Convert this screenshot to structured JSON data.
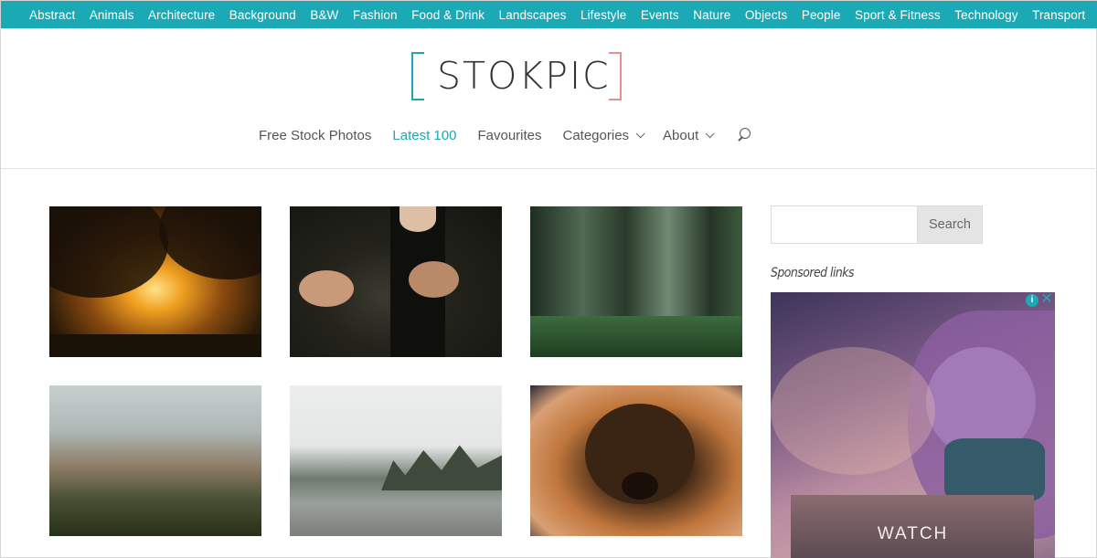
{
  "top_categories": [
    "Abstract",
    "Animals",
    "Architecture",
    "Background",
    "B&W",
    "Fashion",
    "Food & Drink",
    "Landscapes",
    "Lifestyle",
    "Events",
    "Nature",
    "Objects",
    "People",
    "Sport & Fitness",
    "Technology",
    "Transport"
  ],
  "logo": {
    "text": "STOKPIC"
  },
  "main_nav": {
    "free_stock_photos": "Free Stock Photos",
    "latest_100": "Latest 100",
    "favourites": "Favourites",
    "categories": "Categories",
    "about": "About"
  },
  "sidebar": {
    "search_placeholder": "",
    "search_button": "Search",
    "sponsored_label": "Sponsored links"
  },
  "ad": {
    "watch_text": "WATCH"
  },
  "colors": {
    "accent": "#1ca9b6",
    "logo_right_bracket": "#e98f8f"
  },
  "icons": [
    "search-icon",
    "chevron-down-icon",
    "info-icon",
    "close-icon"
  ]
}
